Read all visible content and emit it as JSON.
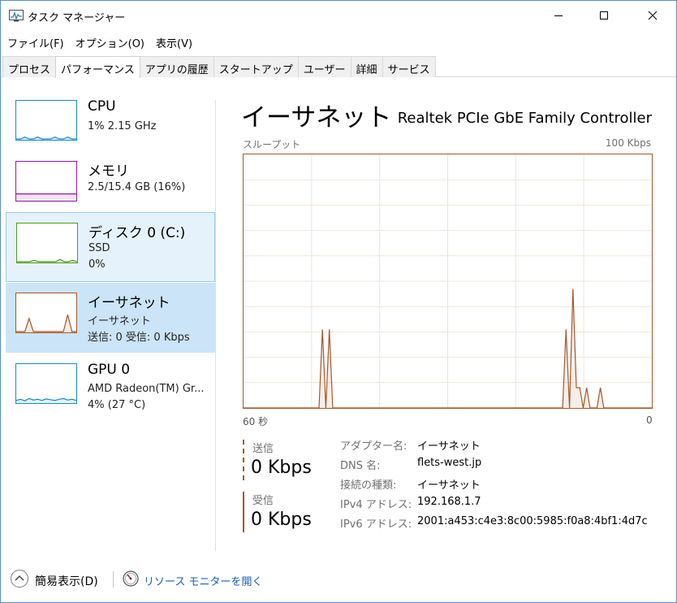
{
  "window": {
    "title": "タスク マネージャー",
    "controls": {
      "minimize": "minimize",
      "maximize": "maximize",
      "close": "close"
    }
  },
  "menu": [
    "ファイル(F)",
    "オプション(O)",
    "表示(V)"
  ],
  "tabs": [
    {
      "label": "プロセス",
      "active": false
    },
    {
      "label": "パフォーマンス",
      "active": true
    },
    {
      "label": "アプリの履歴",
      "active": false
    },
    {
      "label": "スタートアップ",
      "active": false
    },
    {
      "label": "ユーザー",
      "active": false
    },
    {
      "label": "詳細",
      "active": false
    },
    {
      "label": "サービス",
      "active": false
    }
  ],
  "sidebar": [
    {
      "title": "CPU",
      "line1": "1% 2.15 GHz",
      "line2": "",
      "color": "#1a8ac6",
      "state": "normal",
      "spark": [
        0,
        0,
        0.05,
        0,
        0,
        0.05,
        0,
        0,
        0,
        0.05,
        0,
        0,
        0.05,
        0,
        0
      ]
    },
    {
      "title": "メモリ",
      "line1": "2.5/15.4 GB (16%)",
      "line2": "",
      "color": "#8b1ca3",
      "state": "normal",
      "spark": [
        0.16,
        0.16,
        0.16,
        0.16,
        0.16,
        0.16,
        0.16,
        0.16,
        0.16,
        0.16,
        0.16,
        0.16,
        0.16,
        0.16,
        0.16
      ]
    },
    {
      "title": "ディスク 0 (C:)",
      "line1": "SSD",
      "line2": "0%",
      "color": "#4c9b1a",
      "state": "hover",
      "spark": [
        0,
        0,
        0,
        0,
        0.04,
        0,
        0,
        0,
        0,
        0,
        0.06,
        0,
        0,
        0.04,
        0
      ]
    },
    {
      "title": "イーサネット",
      "line1": "イーサネット",
      "line2": "送信: 0  受信: 0 Kbps",
      "color": "#a5582a",
      "state": "selected",
      "spark": [
        0,
        0,
        0,
        0.35,
        0,
        0,
        0,
        0,
        0,
        0,
        0,
        0,
        0.45,
        0,
        0
      ]
    },
    {
      "title": "GPU 0",
      "line1": "AMD Radeon(TM) Gr...",
      "line2": "4% (27 °C)",
      "color": "#1a8ac6",
      "state": "normal",
      "spark": [
        0.05,
        0.08,
        0.04,
        0.1,
        0.06,
        0.08,
        0.05,
        0.09,
        0.07,
        0.05,
        0.08,
        0.1,
        0.06,
        0.08,
        0.05
      ]
    }
  ],
  "main": {
    "title": "イーサネット",
    "adapter": "Realtek PCIe GbE Family Controller",
    "throughput_label": "スループット",
    "max_label": "100 Kbps",
    "x_left": "60 秒",
    "x_right": "0",
    "color": "#a5582a",
    "send": {
      "label": "送信",
      "value": "0 Kbps"
    },
    "receive": {
      "label": "受信",
      "value": "0 Kbps"
    },
    "properties": [
      {
        "key": "アダプター名:",
        "value": "イーサネット"
      },
      {
        "key": "DNS 名:",
        "value": "flets-west.jp"
      },
      {
        "key": "接続の種類:",
        "value": "イーサネット"
      },
      {
        "key": "IPv4 アドレス:",
        "value": "192.168.1.7"
      },
      {
        "key": "IPv6 アドレス:",
        "value": "2001:a453:c4e3:8c00:5985:f0a8:4bf1:4d7c"
      }
    ]
  },
  "chart_data": {
    "type": "area",
    "xlabel": "",
    "ylabel": "スループット",
    "xlim": [
      60,
      0
    ],
    "ylim": [
      0,
      100
    ],
    "x_tick_labels": [
      "60 秒",
      "0"
    ],
    "y_max_label": "100 Kbps",
    "grid": true,
    "series": [
      {
        "values": [
          0,
          0,
          0,
          0,
          0,
          0,
          0,
          0,
          0,
          0,
          0,
          0,
          0,
          0,
          0,
          0,
          0,
          0,
          0,
          0,
          0,
          0,
          0,
          31,
          0,
          31,
          0,
          0,
          0,
          0,
          0,
          0,
          0,
          0,
          0,
          0,
          0,
          0,
          0,
          0,
          0,
          0,
          0,
          0,
          0,
          0,
          0,
          0,
          0,
          0,
          0,
          0,
          0,
          0,
          0,
          0,
          0,
          0,
          0,
          0,
          0,
          0,
          0,
          0,
          0,
          0,
          0,
          0,
          0,
          0,
          0,
          0,
          0,
          0,
          0,
          0,
          0,
          0,
          0,
          0,
          0,
          0,
          0,
          0,
          0,
          0,
          0,
          0,
          0,
          0,
          0,
          0,
          0,
          0,
          31,
          0,
          47,
          8,
          8,
          0,
          8,
          0,
          0,
          0,
          8,
          0,
          0,
          0,
          0,
          0,
          0,
          0,
          0,
          0,
          0,
          0,
          0,
          0,
          0,
          0
        ]
      }
    ]
  },
  "footer": {
    "fewer_details": "簡易表示(D)",
    "resource_monitor": "リソース モニターを開く"
  }
}
